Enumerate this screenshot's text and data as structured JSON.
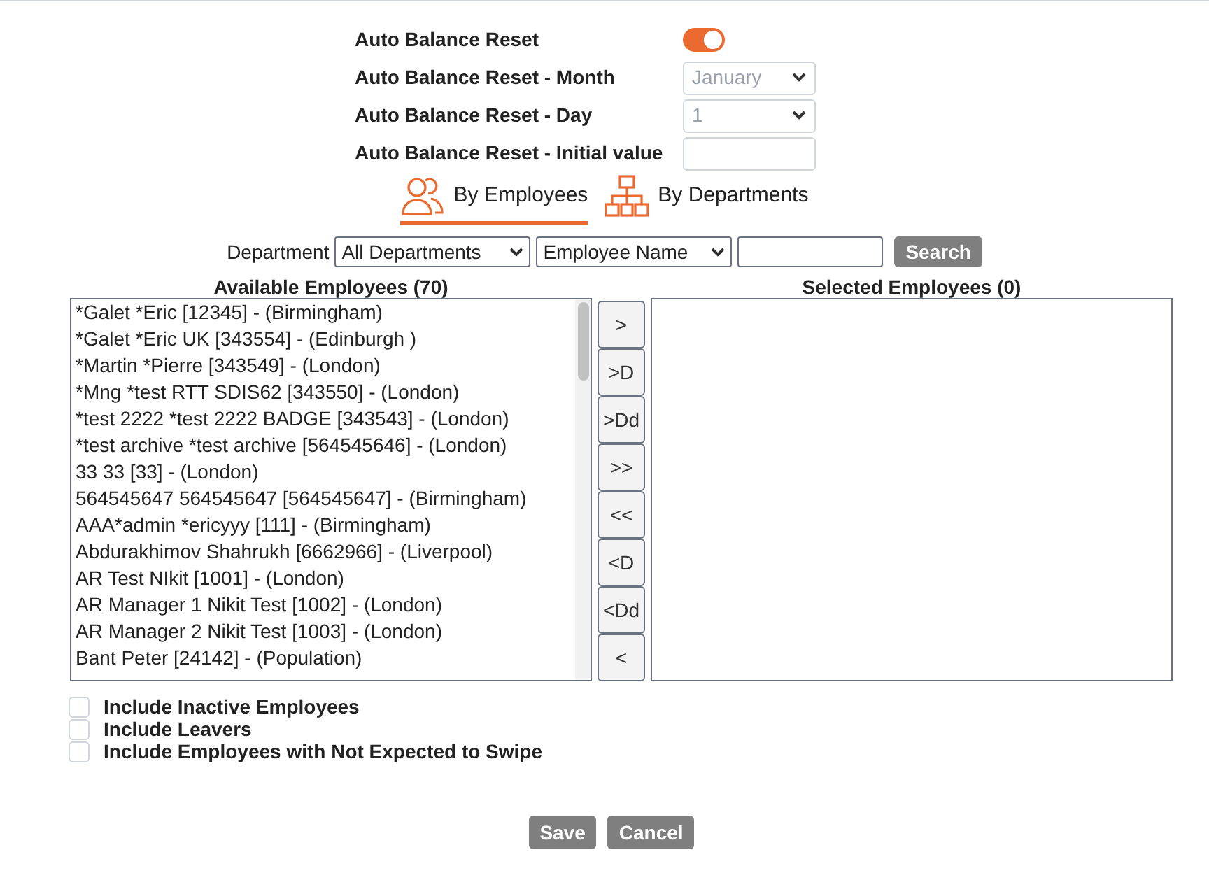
{
  "settings": [
    {
      "kind": "toggle",
      "label": "Auto Balance Reset",
      "on": true
    },
    {
      "kind": "select",
      "label": "Auto Balance Reset - Month",
      "value": "January",
      "disabled": true
    },
    {
      "kind": "select",
      "label": "Auto Balance Reset - Day",
      "value": "1",
      "disabled": true
    },
    {
      "kind": "input",
      "label": "Auto Balance Reset - Initial value"
    }
  ],
  "tabs": [
    {
      "label": "By Employees",
      "kind": "people",
      "selected": true
    },
    {
      "label": "By Departments",
      "kind": "org",
      "selected": false
    }
  ],
  "filter": {
    "label": "Department",
    "department": "All Departments",
    "field": "Employee Name",
    "search_button": "Search"
  },
  "available": {
    "title": "Available Employees (70)",
    "items": [
      "*Galet *Eric [12345] - (Birmingham)",
      "*Galet *Eric UK [343554] - (Edinburgh )",
      "*Martin *Pierre [343549] - (London)",
      "*Mng *test RTT SDIS62 [343550] - (London)",
      "*test 2222 *test 2222 BADGE [343543] - (London)",
      "*test archive *test archive [564545646] - (London)",
      "33 33 [33] - (London)",
      "564545647 564545647 [564545647] - (Birmingham)",
      "AAA*admin *ericyyy [111] - (Birmingham)",
      "Abdurakhimov Shahrukh [6662966] - (Liverpool)",
      "AR Test NIkit [1001] - (London)",
      "AR Manager 1 Nikit Test [1002] - (London)",
      "AR Manager 2 Nikit Test [1003] - (London)",
      "Bant Peter [24142] - (Population)"
    ]
  },
  "move_buttons": [
    ">",
    ">D",
    ">Dd",
    ">>",
    "<<",
    "<D",
    "<Dd",
    "<"
  ],
  "selected": {
    "title": "Selected Employees (0)"
  },
  "options": [
    {
      "label": "Include Inactive Employees",
      "checked": false
    },
    {
      "label": "Include Leavers",
      "checked": false
    },
    {
      "label": "Include Employees with Not Expected to Swipe",
      "checked": false
    }
  ],
  "buttons": [
    "Save",
    "Cancel"
  ]
}
